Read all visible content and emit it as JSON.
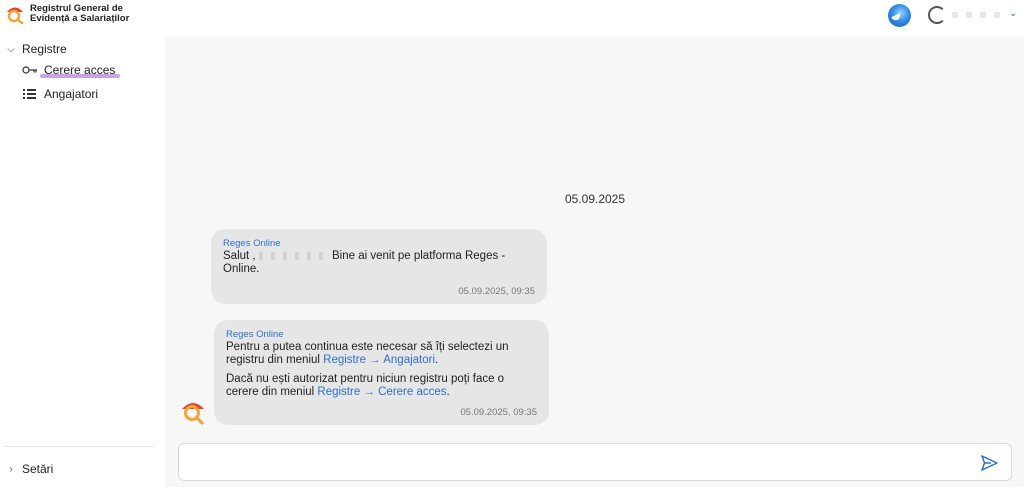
{
  "app": {
    "title_line1": "Registrul General de",
    "title_line2": "Evidență a Salariaților"
  },
  "sidebar": {
    "sections": [
      {
        "label": "Registre",
        "expanded": true,
        "items": [
          {
            "label": "Cerere acces",
            "icon": "key-icon",
            "active": true
          },
          {
            "label": "Angajatori",
            "icon": "list-icon",
            "active": false
          }
        ]
      },
      {
        "label": "Setări",
        "expanded": false
      }
    ]
  },
  "chat": {
    "date": "05.09.2025",
    "messages": [
      {
        "sender": "Reges Online",
        "text_pre": "Salut ,",
        "text_post": "Bine ai venit pe platforma Reges - Online.",
        "time": "05.09.2025, 09:35"
      },
      {
        "sender": "Reges Online",
        "p1_text": "Pentru a putea continua este necesar să îți selectezi un registru din meniul ",
        "p1_link": "Registre → Angajatori",
        "p1_end": ".",
        "p2_text": "Dacă nu ești autorizat pentru niciun registru poți face o cerere din meniul ",
        "p2_link": "Registre → Cerere acces",
        "p2_end": ".",
        "time": "05.09.2025, 09:35"
      }
    ]
  },
  "composer": {
    "value": "",
    "placeholder": ""
  },
  "colors": {
    "accent": "#2c6fd6",
    "active_underline": "#c9a3e6",
    "bubble": "#e6e6e6",
    "logo_red": "#e8452c",
    "logo_orange": "#f2a33a"
  }
}
